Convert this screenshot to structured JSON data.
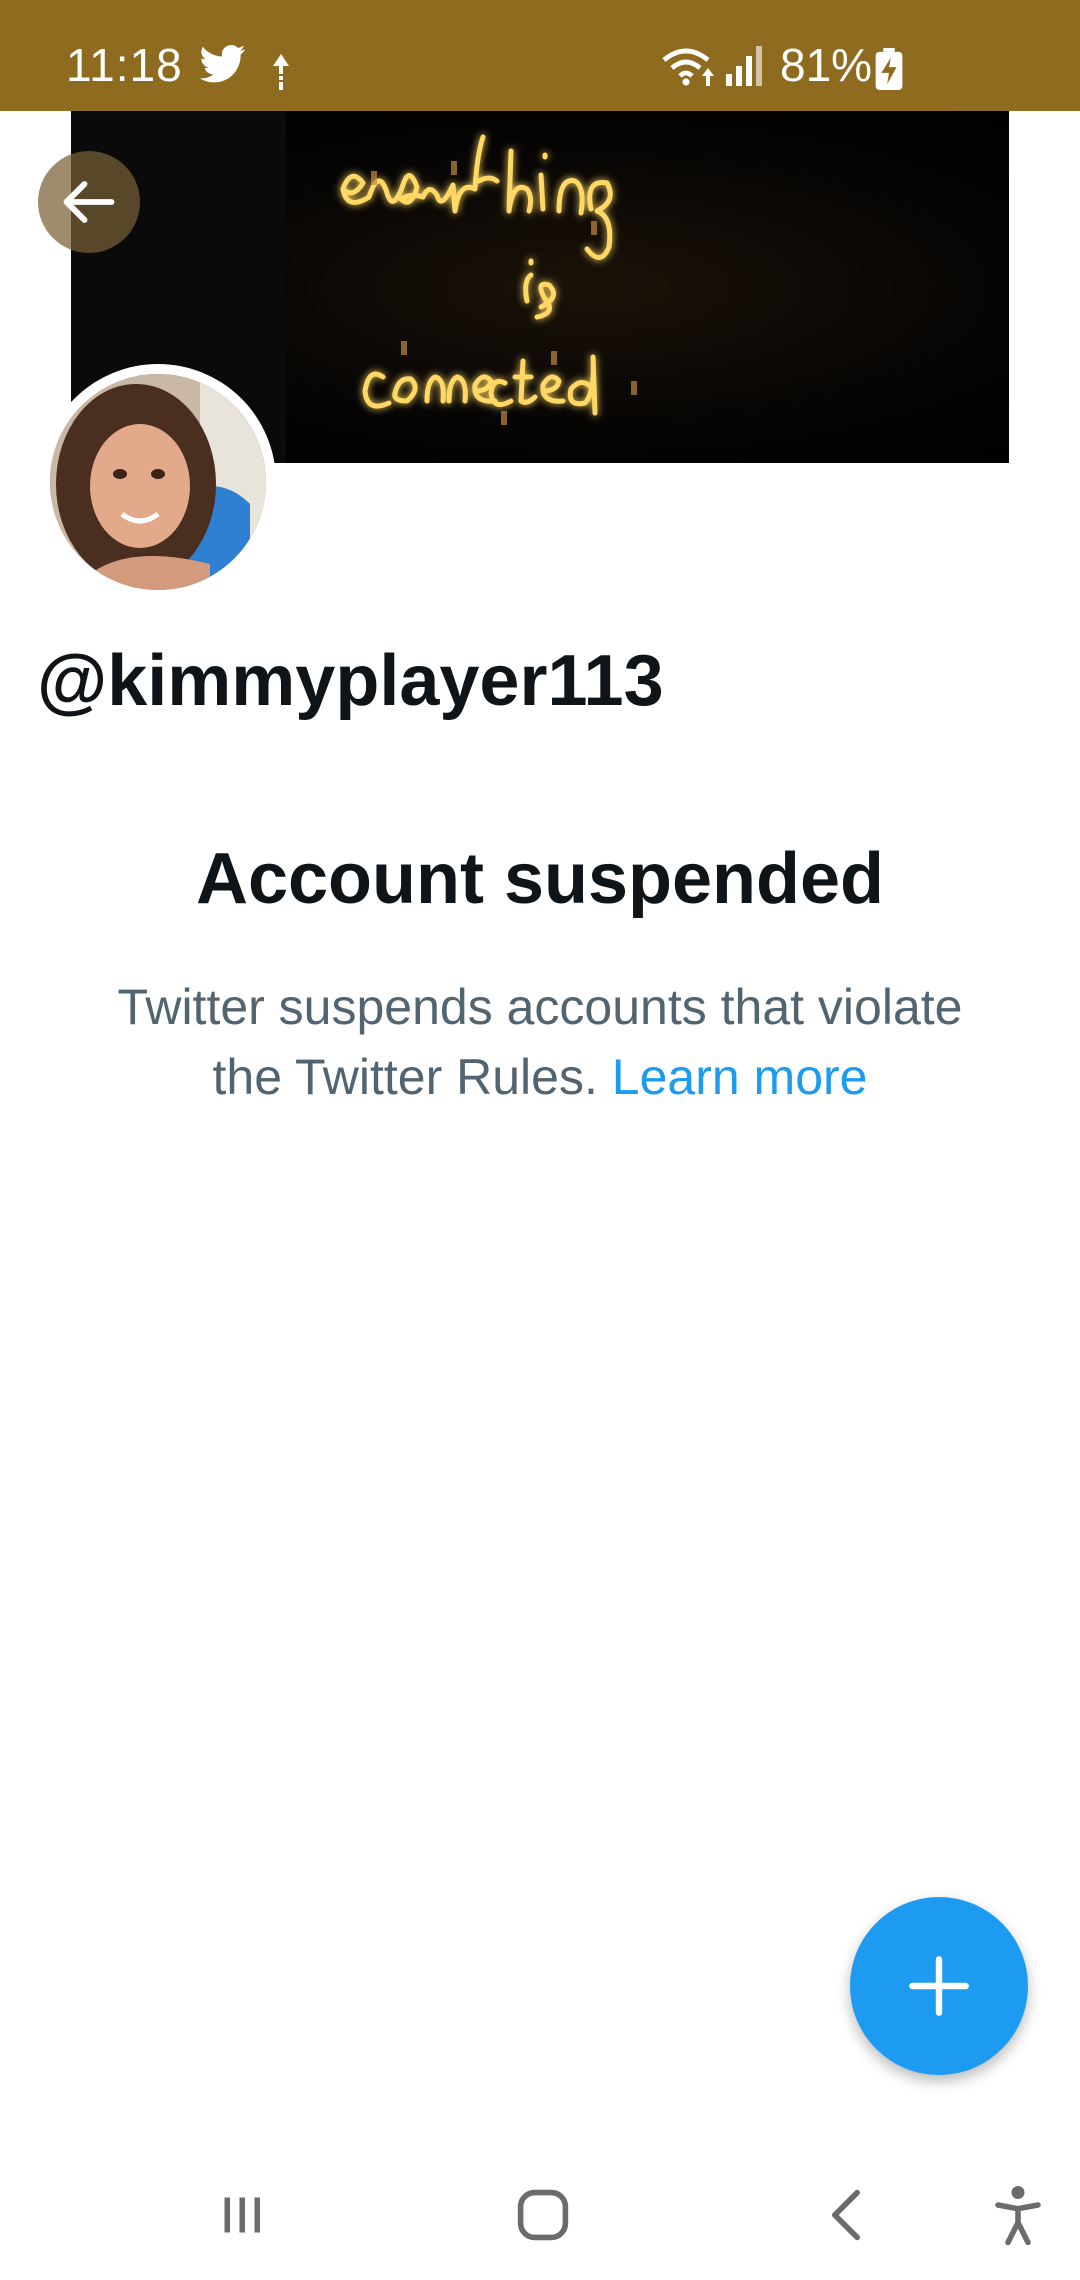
{
  "status_bar": {
    "time": "11:18",
    "battery": "81%",
    "icons": [
      "twitter-icon",
      "data-arrow-icon",
      "wifi-icon",
      "signal-icon",
      "battery-charging-icon"
    ],
    "background_color": "#8f6b1f"
  },
  "header": {
    "banner_text": "everything is connected",
    "back_icon": "arrow-left-icon"
  },
  "profile": {
    "handle": "@kimmyplayer113"
  },
  "suspension": {
    "title": "Account suspended",
    "message": "Twitter suspends accounts that violate the Twitter Rules.",
    "link_label": "Learn more",
    "link_color": "#1d9bf0"
  },
  "fab": {
    "icon": "plus-icon",
    "color": "#1d9bf0"
  },
  "nav_bar": {
    "icons": [
      "recent-apps-icon",
      "home-icon",
      "back-icon",
      "accessibility-icon"
    ]
  }
}
